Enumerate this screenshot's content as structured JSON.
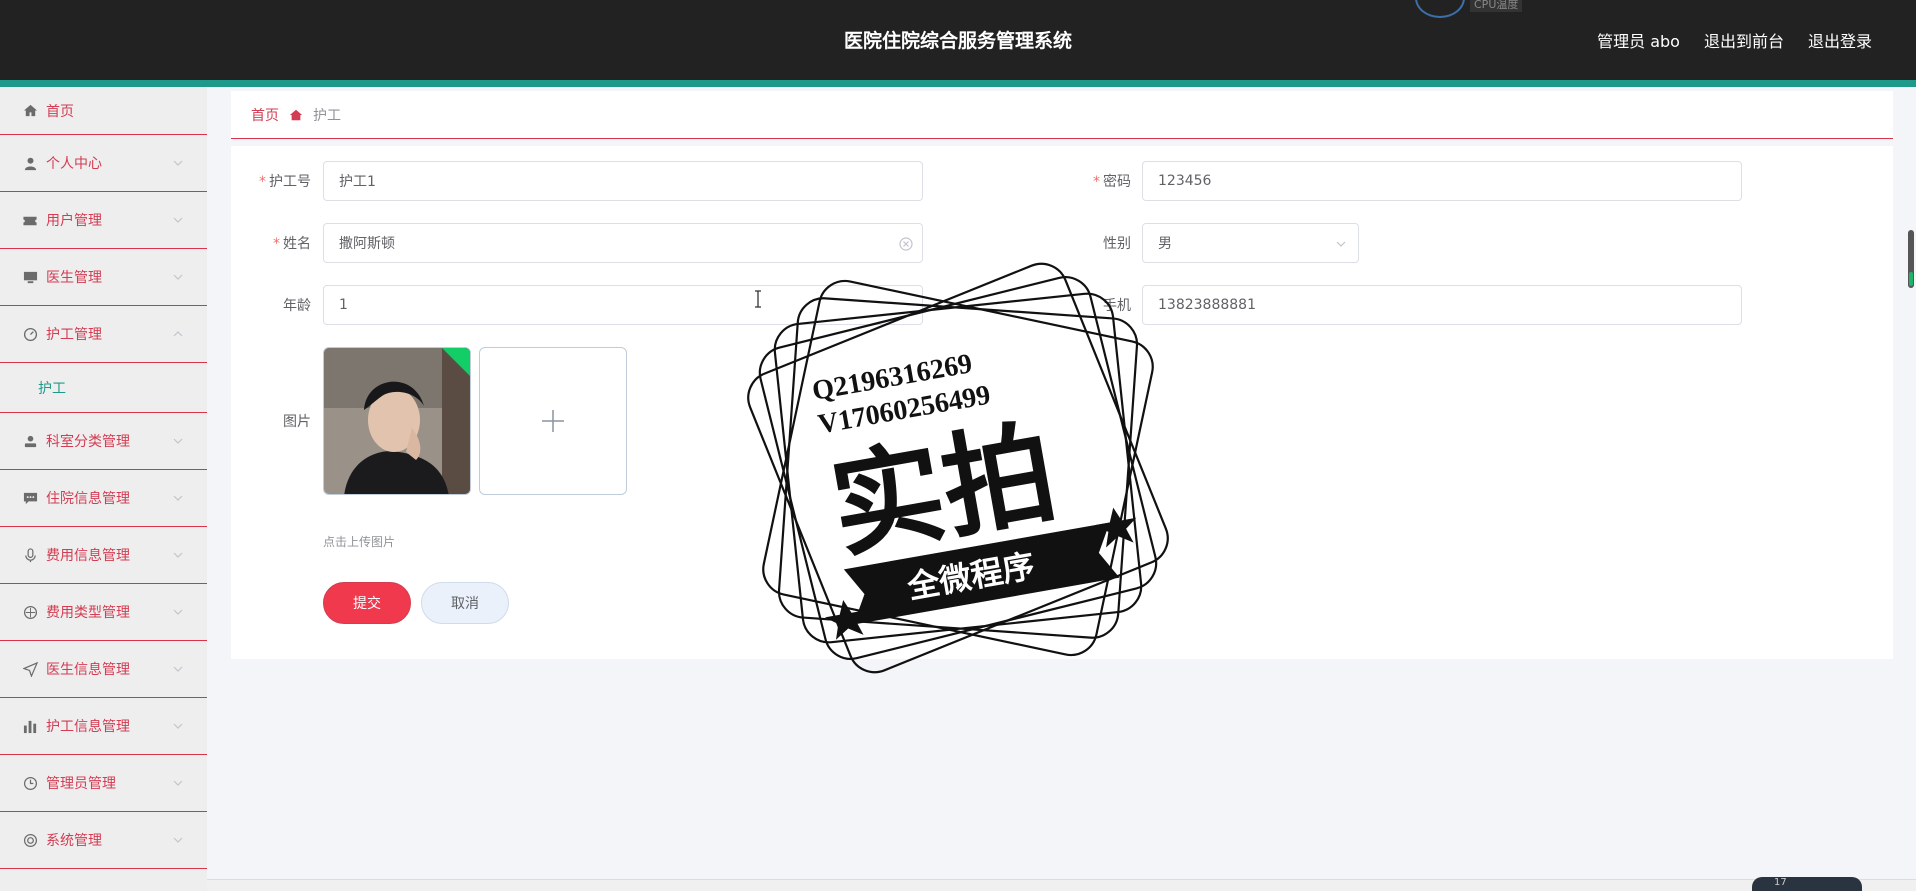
{
  "header": {
    "title": "医院住院综合服务管理系统",
    "user": "管理员 abo",
    "to_front": "退出到前台",
    "logout": "退出登录",
    "cpu_label": "CPU温度"
  },
  "sidebar": {
    "items": [
      {
        "label": "首页",
        "icon": "home-icon"
      },
      {
        "label": "个人中心",
        "icon": "user-icon"
      },
      {
        "label": "用户管理",
        "icon": "ticket-icon"
      },
      {
        "label": "医生管理",
        "icon": "monitor-icon"
      },
      {
        "label": "护工管理",
        "icon": "gauge-icon"
      },
      {
        "label": "科室分类管理",
        "icon": "person-icon"
      },
      {
        "label": "住院信息管理",
        "icon": "chat-icon"
      },
      {
        "label": "费用信息管理",
        "icon": "mic-icon"
      },
      {
        "label": "费用类型管理",
        "icon": "compass-icon"
      },
      {
        "label": "医生信息管理",
        "icon": "send-icon"
      },
      {
        "label": "护工信息管理",
        "icon": "bar-chart-icon"
      },
      {
        "label": "管理员管理",
        "icon": "clock-icon"
      },
      {
        "label": "系统管理",
        "icon": "lifebuoy-icon"
      }
    ],
    "sub_item": "护工"
  },
  "breadcrumb": {
    "home": "首页",
    "current": "护工"
  },
  "form": {
    "nurse_no": {
      "label": "护工号",
      "value": "护工1"
    },
    "password": {
      "label": "密码",
      "value": "123456"
    },
    "name": {
      "label": "姓名",
      "value": "撒阿斯顿"
    },
    "gender": {
      "label": "性别",
      "value": "男"
    },
    "age": {
      "label": "年龄",
      "value": "1"
    },
    "phone": {
      "label": "手机",
      "value": "13823888881"
    },
    "image": {
      "label": "图片"
    },
    "upload_hint": "点击上传图片",
    "submit": "提交",
    "cancel": "取消"
  },
  "watermark": {
    "line1": "Q2196316269",
    "line2": "V17060256499",
    "main": "实拍",
    "banner": "全微程序"
  },
  "taskbar": {
    "net": "17"
  },
  "colors": {
    "header_bg": "#222222",
    "accent": "#1f9a8a",
    "menu_text": "#d33c52",
    "submit_bg": "#f0394d"
  }
}
